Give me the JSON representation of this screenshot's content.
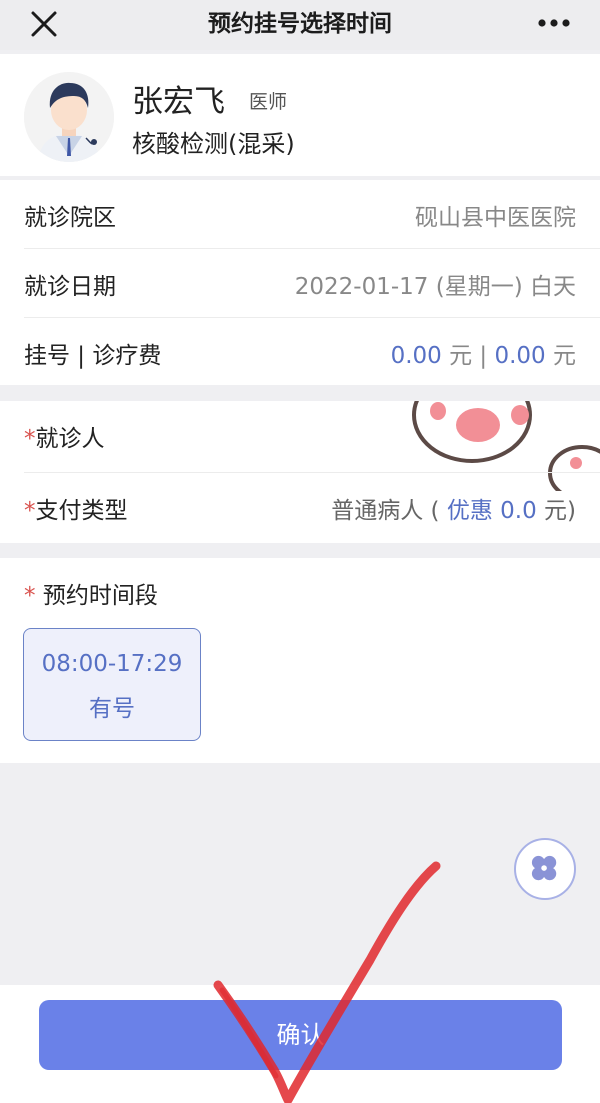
{
  "header": {
    "title": "预约挂号选择时间",
    "more_label": "..."
  },
  "doctor": {
    "name": "张宏飞",
    "title": "医师",
    "department": "核酸检测(混采)"
  },
  "info": {
    "campus_label": "就诊院区",
    "campus_value": "砚山县中医医院",
    "date_label": "就诊日期",
    "date_value": "2022-01-17 (星期一) 白天",
    "fee_label": "挂号 | 诊疗费",
    "fee_reg": "0.00",
    "fee_unit1": "元",
    "fee_sep": "|",
    "fee_treat": "0.00",
    "fee_unit2": "元"
  },
  "patient": {
    "required_mark": "*",
    "patient_label": "就诊人",
    "pay_label": "支付类型",
    "pay_value_prefix": "普通病人 (",
    "pay_discount_label": "优惠",
    "pay_discount_amount": "0.0",
    "pay_value_suffix": "元)"
  },
  "slots": {
    "required_mark": "*",
    "title": "预约时间段",
    "items": [
      {
        "time": "08:00-17:29",
        "status": "有号"
      }
    ]
  },
  "footer": {
    "confirm_label": "确认"
  },
  "colors": {
    "accent": "#5670c4",
    "button": "#6a81e8",
    "required": "#d9534f",
    "annotation": "#e0282d"
  }
}
